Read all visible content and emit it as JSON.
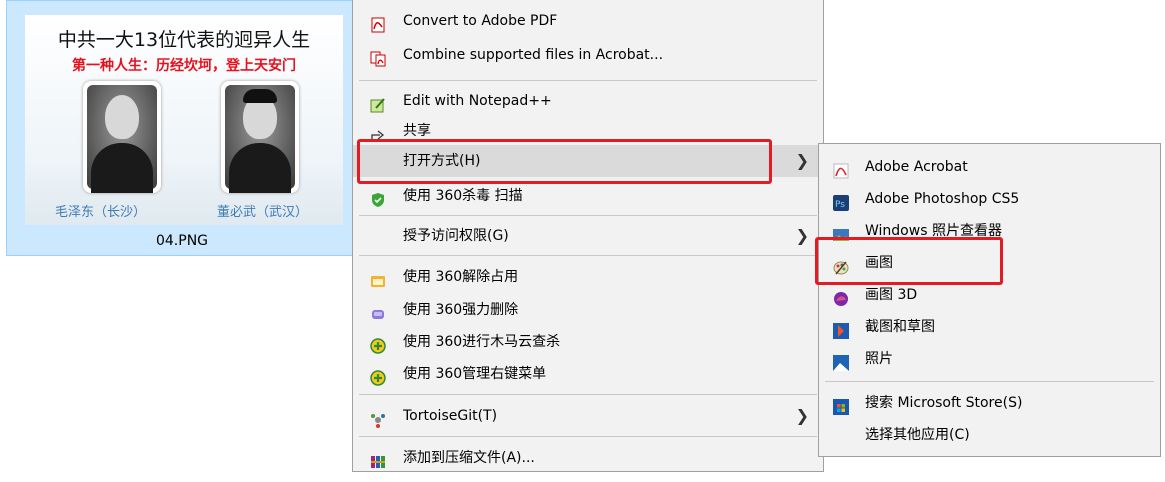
{
  "file": {
    "thumbnail_title": "中共一大13位代表的迥异人生",
    "thumbnail_subtitle": "第一种人生：历经坎坷，登上天安门",
    "caption_left": "毛泽东（长沙）",
    "caption_right": "董必武（武汉）",
    "name": "04.PNG"
  },
  "menu": {
    "items": [
      {
        "label": "Convert to Adobe PDF",
        "icon": "adobe-pdf-icon"
      },
      {
        "label": "Combine supported files in Acrobat...",
        "icon": "acrobat-combine-icon"
      },
      {
        "label": "Edit with Notepad++",
        "icon": "notepad-plus-plus-icon"
      },
      {
        "label": "共享",
        "icon": "share-icon"
      },
      {
        "label": "打开方式(H)",
        "icon": ""
      },
      {
        "label": "使用 360杀毒 扫描",
        "icon": "360-antivirus-icon"
      },
      {
        "label": "授予访问权限(G)",
        "icon": ""
      },
      {
        "label": "使用 360解除占用",
        "icon": "360-unlock-icon"
      },
      {
        "label": "使用 360强力删除",
        "icon": "360-delete-icon"
      },
      {
        "label": "使用 360进行木马云查杀",
        "icon": "360-trojan-scan-icon"
      },
      {
        "label": "使用 360管理右键菜单",
        "icon": "360-menu-manager-icon"
      },
      {
        "label": "TortoiseGit(T)",
        "icon": "tortoisegit-icon"
      },
      {
        "label": "添加到压缩文件(A)...",
        "icon": "winrar-icon"
      }
    ],
    "submenu_arrow": "❯"
  },
  "submenu": {
    "items": [
      {
        "label": "Adobe Acrobat",
        "icon": "adobe-acrobat-icon"
      },
      {
        "label": "Adobe Photoshop CS5",
        "icon": "photoshop-icon"
      },
      {
        "label": "Windows 照片查看器",
        "icon": "photo-viewer-icon"
      },
      {
        "label": "画图",
        "icon": "paint-icon"
      },
      {
        "label": "画图 3D",
        "icon": "paint-3d-icon"
      },
      {
        "label": "截图和草图",
        "icon": "snip-sketch-icon"
      },
      {
        "label": "照片",
        "icon": "photos-icon"
      },
      {
        "label": "搜索 Microsoft Store(S)",
        "icon": "microsoft-store-icon"
      },
      {
        "label": "选择其他应用(C)",
        "icon": ""
      }
    ]
  },
  "colors": {
    "highlight": "#e51b23",
    "selection": "#cce8ff"
  }
}
